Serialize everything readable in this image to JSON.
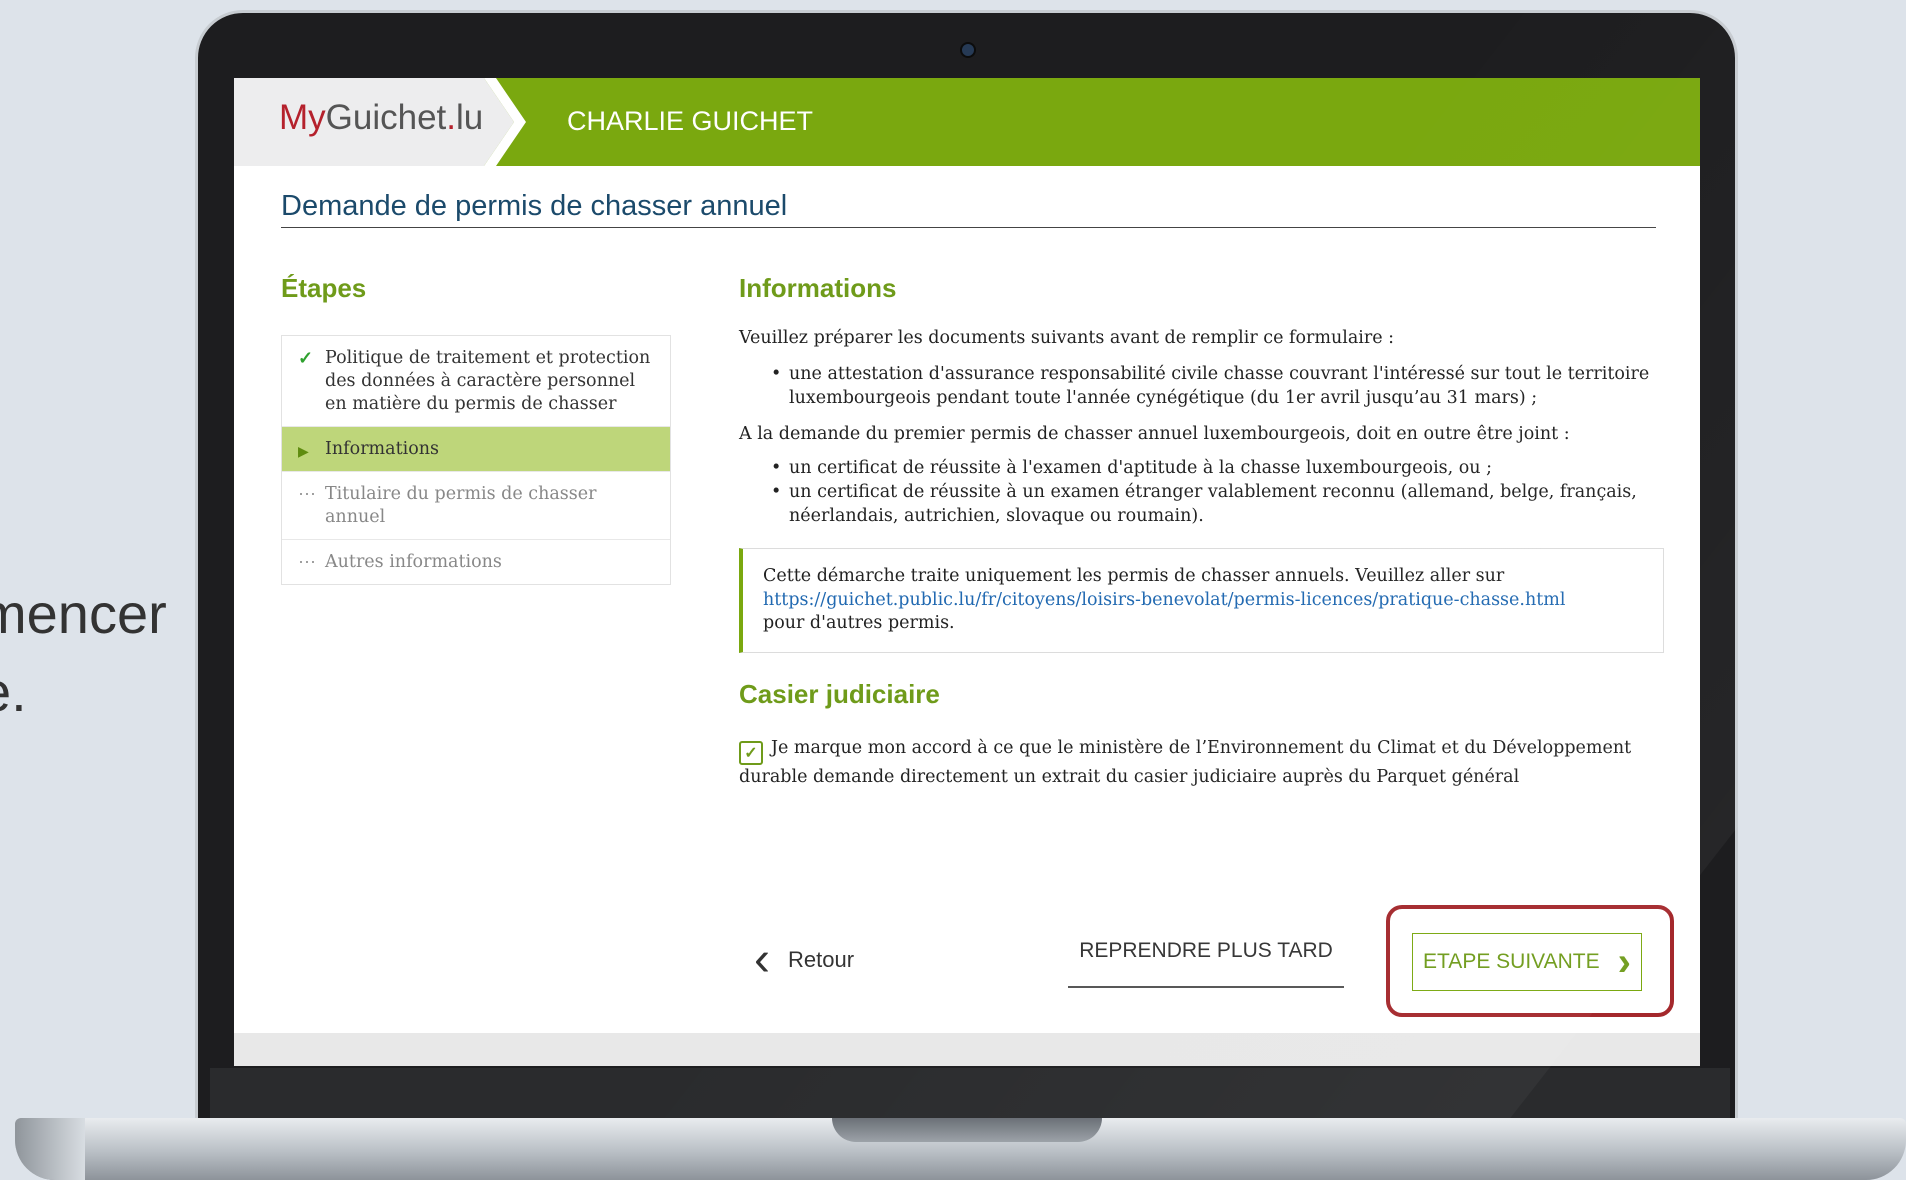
{
  "side_text": [
    "mencer",
    "e."
  ],
  "header": {
    "logo_my": "My",
    "logo_guichet": "Guichet",
    "logo_dot": ".",
    "logo_lu": "lu",
    "app_name": "CHARLIE GUICHET"
  },
  "page_title": "Demande de permis de chasser annuel",
  "steps": {
    "heading": "Étapes",
    "items": [
      {
        "label": "Politique de traitement et protection des données à caractère personnel en matière du permis de chasser",
        "state": "done",
        "icon": "check-icon"
      },
      {
        "label": "Informations",
        "state": "active",
        "icon": "triangle-right-icon"
      },
      {
        "label": "Titulaire du permis de chasser annuel",
        "state": "todo",
        "icon": "ellipsis-icon"
      },
      {
        "label": "Autres informations",
        "state": "todo",
        "icon": "ellipsis-icon"
      }
    ]
  },
  "main": {
    "informations_heading": "Informations",
    "intro": "Veuillez préparer les documents suivants avant de remplir ce formulaire :",
    "list1": [
      "une attestation d'assurance responsabilité civile chasse couvrant l'intéressé sur tout le territoire luxembourgeois pendant toute l'année cynégétique (du 1er avril jusqu’au 31 mars) ;"
    ],
    "intro2": "A la demande du premier permis de chasser annuel luxembourgeois, doit en outre être joint :",
    "list2": [
      "un certificat de réussite à l'examen d'aptitude à la chasse luxembourgeois, ou ;",
      "un certificat de réussite à un examen étranger valablement reconnu (allemand, belge, français, néerlandais, autrichien, slovaque ou roumain)."
    ],
    "notice_text1": "Cette démarche traite uniquement les permis de chasser annuels. Veuillez aller sur",
    "notice_link": "https://guichet.public.lu/fr/citoyens/loisirs-benevolat/permis-licences/pratique-chasse.html",
    "notice_text2": "pour d'autres permis.",
    "casier_heading": "Casier judiciaire",
    "consent_checked": true,
    "consent_text": "Je marque mon accord à ce que le ministère de l’Environnement du Climat et du Développement durable demande directement un extrait du casier judiciaire auprès du Parquet général"
  },
  "buttons": {
    "back": "Retour",
    "later": "REPRENDRE PLUS TARD",
    "next": "ETAPE SUIVANTE"
  },
  "colors": {
    "brand_green": "#7aa80f",
    "highlight_red": "#a4282c",
    "link_blue": "#2169b1"
  }
}
